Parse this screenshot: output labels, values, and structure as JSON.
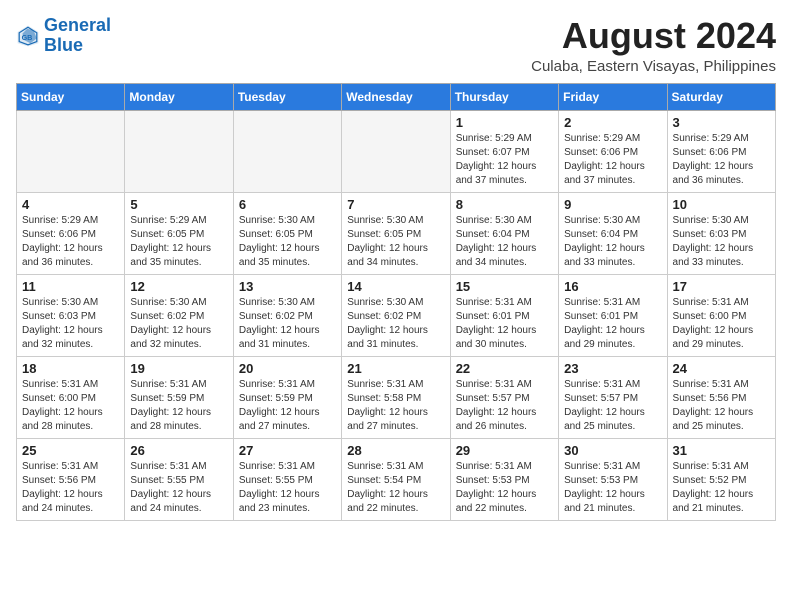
{
  "header": {
    "logo_line1": "General",
    "logo_line2": "Blue",
    "month_year": "August 2024",
    "location": "Culaba, Eastern Visayas, Philippines"
  },
  "weekdays": [
    "Sunday",
    "Monday",
    "Tuesday",
    "Wednesday",
    "Thursday",
    "Friday",
    "Saturday"
  ],
  "weeks": [
    [
      {
        "day": "",
        "info": ""
      },
      {
        "day": "",
        "info": ""
      },
      {
        "day": "",
        "info": ""
      },
      {
        "day": "",
        "info": ""
      },
      {
        "day": "1",
        "info": "Sunrise: 5:29 AM\nSunset: 6:07 PM\nDaylight: 12 hours\nand 37 minutes."
      },
      {
        "day": "2",
        "info": "Sunrise: 5:29 AM\nSunset: 6:06 PM\nDaylight: 12 hours\nand 37 minutes."
      },
      {
        "day": "3",
        "info": "Sunrise: 5:29 AM\nSunset: 6:06 PM\nDaylight: 12 hours\nand 36 minutes."
      }
    ],
    [
      {
        "day": "4",
        "info": "Sunrise: 5:29 AM\nSunset: 6:06 PM\nDaylight: 12 hours\nand 36 minutes."
      },
      {
        "day": "5",
        "info": "Sunrise: 5:29 AM\nSunset: 6:05 PM\nDaylight: 12 hours\nand 35 minutes."
      },
      {
        "day": "6",
        "info": "Sunrise: 5:30 AM\nSunset: 6:05 PM\nDaylight: 12 hours\nand 35 minutes."
      },
      {
        "day": "7",
        "info": "Sunrise: 5:30 AM\nSunset: 6:05 PM\nDaylight: 12 hours\nand 34 minutes."
      },
      {
        "day": "8",
        "info": "Sunrise: 5:30 AM\nSunset: 6:04 PM\nDaylight: 12 hours\nand 34 minutes."
      },
      {
        "day": "9",
        "info": "Sunrise: 5:30 AM\nSunset: 6:04 PM\nDaylight: 12 hours\nand 33 minutes."
      },
      {
        "day": "10",
        "info": "Sunrise: 5:30 AM\nSunset: 6:03 PM\nDaylight: 12 hours\nand 33 minutes."
      }
    ],
    [
      {
        "day": "11",
        "info": "Sunrise: 5:30 AM\nSunset: 6:03 PM\nDaylight: 12 hours\nand 32 minutes."
      },
      {
        "day": "12",
        "info": "Sunrise: 5:30 AM\nSunset: 6:02 PM\nDaylight: 12 hours\nand 32 minutes."
      },
      {
        "day": "13",
        "info": "Sunrise: 5:30 AM\nSunset: 6:02 PM\nDaylight: 12 hours\nand 31 minutes."
      },
      {
        "day": "14",
        "info": "Sunrise: 5:30 AM\nSunset: 6:02 PM\nDaylight: 12 hours\nand 31 minutes."
      },
      {
        "day": "15",
        "info": "Sunrise: 5:31 AM\nSunset: 6:01 PM\nDaylight: 12 hours\nand 30 minutes."
      },
      {
        "day": "16",
        "info": "Sunrise: 5:31 AM\nSunset: 6:01 PM\nDaylight: 12 hours\nand 29 minutes."
      },
      {
        "day": "17",
        "info": "Sunrise: 5:31 AM\nSunset: 6:00 PM\nDaylight: 12 hours\nand 29 minutes."
      }
    ],
    [
      {
        "day": "18",
        "info": "Sunrise: 5:31 AM\nSunset: 6:00 PM\nDaylight: 12 hours\nand 28 minutes."
      },
      {
        "day": "19",
        "info": "Sunrise: 5:31 AM\nSunset: 5:59 PM\nDaylight: 12 hours\nand 28 minutes."
      },
      {
        "day": "20",
        "info": "Sunrise: 5:31 AM\nSunset: 5:59 PM\nDaylight: 12 hours\nand 27 minutes."
      },
      {
        "day": "21",
        "info": "Sunrise: 5:31 AM\nSunset: 5:58 PM\nDaylight: 12 hours\nand 27 minutes."
      },
      {
        "day": "22",
        "info": "Sunrise: 5:31 AM\nSunset: 5:57 PM\nDaylight: 12 hours\nand 26 minutes."
      },
      {
        "day": "23",
        "info": "Sunrise: 5:31 AM\nSunset: 5:57 PM\nDaylight: 12 hours\nand 25 minutes."
      },
      {
        "day": "24",
        "info": "Sunrise: 5:31 AM\nSunset: 5:56 PM\nDaylight: 12 hours\nand 25 minutes."
      }
    ],
    [
      {
        "day": "25",
        "info": "Sunrise: 5:31 AM\nSunset: 5:56 PM\nDaylight: 12 hours\nand 24 minutes."
      },
      {
        "day": "26",
        "info": "Sunrise: 5:31 AM\nSunset: 5:55 PM\nDaylight: 12 hours\nand 24 minutes."
      },
      {
        "day": "27",
        "info": "Sunrise: 5:31 AM\nSunset: 5:55 PM\nDaylight: 12 hours\nand 23 minutes."
      },
      {
        "day": "28",
        "info": "Sunrise: 5:31 AM\nSunset: 5:54 PM\nDaylight: 12 hours\nand 22 minutes."
      },
      {
        "day": "29",
        "info": "Sunrise: 5:31 AM\nSunset: 5:53 PM\nDaylight: 12 hours\nand 22 minutes."
      },
      {
        "day": "30",
        "info": "Sunrise: 5:31 AM\nSunset: 5:53 PM\nDaylight: 12 hours\nand 21 minutes."
      },
      {
        "day": "31",
        "info": "Sunrise: 5:31 AM\nSunset: 5:52 PM\nDaylight: 12 hours\nand 21 minutes."
      }
    ]
  ]
}
